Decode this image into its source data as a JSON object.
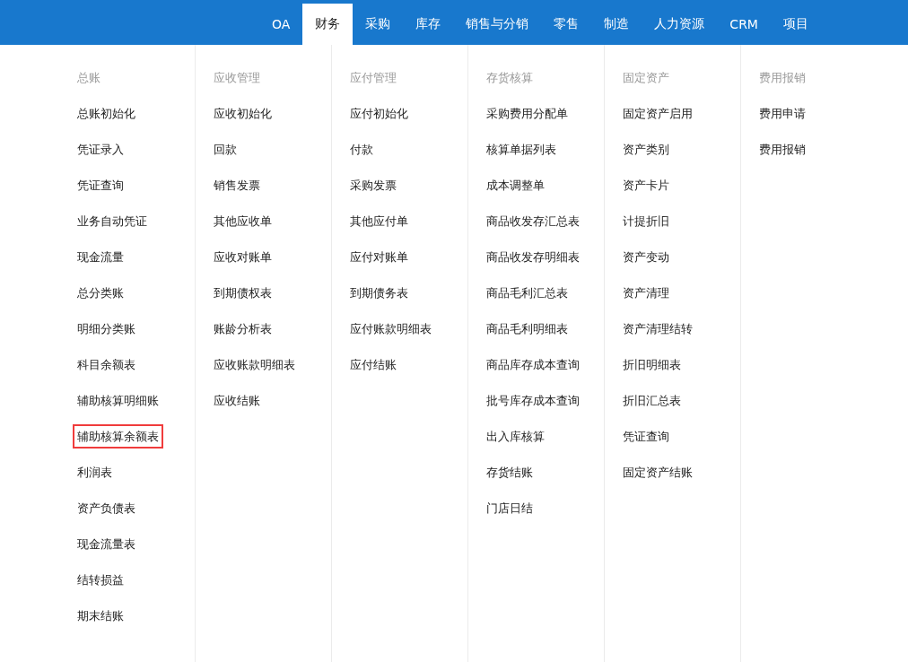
{
  "nav": [
    {
      "label": "OA",
      "selected": false
    },
    {
      "label": "财务",
      "selected": true
    },
    {
      "label": "采购",
      "selected": false
    },
    {
      "label": "库存",
      "selected": false
    },
    {
      "label": "销售与分销",
      "selected": false
    },
    {
      "label": "零售",
      "selected": false
    },
    {
      "label": "制造",
      "selected": false
    },
    {
      "label": "人力资源",
      "selected": false
    },
    {
      "label": "CRM",
      "selected": false
    },
    {
      "label": "项目",
      "selected": false
    }
  ],
  "columns": [
    {
      "heading": "总账",
      "items": [
        {
          "label": "总账初始化",
          "highlighted": false
        },
        {
          "label": "凭证录入",
          "highlighted": false
        },
        {
          "label": "凭证查询",
          "highlighted": false
        },
        {
          "label": "业务自动凭证",
          "highlighted": false
        },
        {
          "label": "现金流量",
          "highlighted": false
        },
        {
          "label": "总分类账",
          "highlighted": false
        },
        {
          "label": "明细分类账",
          "highlighted": false
        },
        {
          "label": "科目余额表",
          "highlighted": false
        },
        {
          "label": "辅助核算明细账",
          "highlighted": false
        },
        {
          "label": "辅助核算余额表",
          "highlighted": true
        },
        {
          "label": "利润表",
          "highlighted": false
        },
        {
          "label": "资产负债表",
          "highlighted": false
        },
        {
          "label": "现金流量表",
          "highlighted": false
        },
        {
          "label": "结转损益",
          "highlighted": false
        },
        {
          "label": "期末结账",
          "highlighted": false
        }
      ]
    },
    {
      "heading": "应收管理",
      "items": [
        {
          "label": "应收初始化",
          "highlighted": false
        },
        {
          "label": "回款",
          "highlighted": false
        },
        {
          "label": "销售发票",
          "highlighted": false
        },
        {
          "label": "其他应收单",
          "highlighted": false
        },
        {
          "label": "应收对账单",
          "highlighted": false
        },
        {
          "label": "到期债权表",
          "highlighted": false
        },
        {
          "label": "账龄分析表",
          "highlighted": false
        },
        {
          "label": "应收账款明细表",
          "highlighted": false
        },
        {
          "label": "应收结账",
          "highlighted": false
        }
      ]
    },
    {
      "heading": "应付管理",
      "items": [
        {
          "label": "应付初始化",
          "highlighted": false
        },
        {
          "label": "付款",
          "highlighted": false
        },
        {
          "label": "采购发票",
          "highlighted": false
        },
        {
          "label": "其他应付单",
          "highlighted": false
        },
        {
          "label": "应付对账单",
          "highlighted": false
        },
        {
          "label": "到期债务表",
          "highlighted": false
        },
        {
          "label": "应付账款明细表",
          "highlighted": false
        },
        {
          "label": "应付结账",
          "highlighted": false
        }
      ]
    },
    {
      "heading": "存货核算",
      "items": [
        {
          "label": "采购费用分配单",
          "highlighted": false
        },
        {
          "label": "核算单据列表",
          "highlighted": false
        },
        {
          "label": "成本调整单",
          "highlighted": false
        },
        {
          "label": "商品收发存汇总表",
          "highlighted": false
        },
        {
          "label": "商品收发存明细表",
          "highlighted": false
        },
        {
          "label": "商品毛利汇总表",
          "highlighted": false
        },
        {
          "label": "商品毛利明细表",
          "highlighted": false
        },
        {
          "label": "商品库存成本查询",
          "highlighted": false
        },
        {
          "label": "批号库存成本查询",
          "highlighted": false
        },
        {
          "label": "出入库核算",
          "highlighted": false
        },
        {
          "label": "存货结账",
          "highlighted": false
        },
        {
          "label": "门店日结",
          "highlighted": false
        }
      ]
    },
    {
      "heading": "固定资产",
      "items": [
        {
          "label": "固定资产启用",
          "highlighted": false
        },
        {
          "label": "资产类别",
          "highlighted": false
        },
        {
          "label": "资产卡片",
          "highlighted": false
        },
        {
          "label": "计提折旧",
          "highlighted": false
        },
        {
          "label": "资产变动",
          "highlighted": false
        },
        {
          "label": "资产清理",
          "highlighted": false
        },
        {
          "label": "资产清理结转",
          "highlighted": false
        },
        {
          "label": "折旧明细表",
          "highlighted": false
        },
        {
          "label": "折旧汇总表",
          "highlighted": false
        },
        {
          "label": "凭证查询",
          "highlighted": false
        },
        {
          "label": "固定资产结账",
          "highlighted": false
        }
      ]
    },
    {
      "heading": "费用报销",
      "items": [
        {
          "label": "费用申请",
          "highlighted": false
        },
        {
          "label": "费用报销",
          "highlighted": false
        }
      ]
    }
  ]
}
